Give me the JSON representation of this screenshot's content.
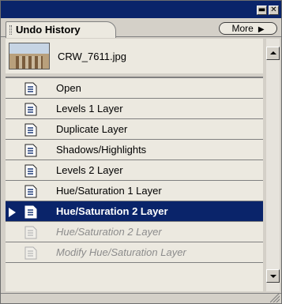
{
  "title_bar": {
    "minimize_glyph": "▬",
    "close_glyph": "✕"
  },
  "tab": {
    "label": "Undo History"
  },
  "more_button": {
    "label": "More",
    "arrow": "▶"
  },
  "snapshot": {
    "label": "CRW_7611.jpg"
  },
  "history": {
    "items": [
      {
        "label": "Open",
        "state": "normal"
      },
      {
        "label": "Levels 1 Layer",
        "state": "normal"
      },
      {
        "label": "Duplicate Layer",
        "state": "normal"
      },
      {
        "label": "Shadows/Highlights",
        "state": "normal"
      },
      {
        "label": "Levels 2 Layer",
        "state": "normal"
      },
      {
        "label": "Hue/Saturation 1 Layer",
        "state": "normal"
      },
      {
        "label": "Hue/Saturation 2 Layer",
        "state": "selected"
      },
      {
        "label": "Hue/Saturation 2 Layer",
        "state": "undone"
      },
      {
        "label": "Modify Hue/Saturation Layer",
        "state": "undone"
      }
    ]
  },
  "colors": {
    "title_bar": "#0a246a",
    "selection": "#0a246a",
    "panel": "#d4d0c8",
    "list_bg": "#ece9e0",
    "undone_text": "#8c8c8c"
  }
}
